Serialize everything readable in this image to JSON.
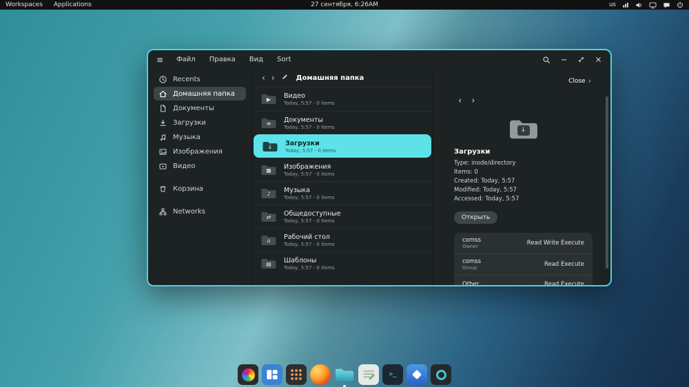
{
  "topbar": {
    "workspaces": "Workspaces",
    "applications": "Applications",
    "clock": "27 сентября, 6:26AM",
    "keyboard_layout": "us",
    "icons": [
      "network-icon",
      "volume-icon",
      "display-icon",
      "chat-icon",
      "power-icon"
    ]
  },
  "window": {
    "menus": [
      "Файл",
      "Правка",
      "Вид",
      "Sort"
    ],
    "sidebar": {
      "items": [
        {
          "label": "Recents",
          "icon": "clock-icon"
        },
        {
          "label": "Домашняя папка",
          "icon": "home-icon",
          "selected": true
        },
        {
          "label": "Документы",
          "icon": "document-icon"
        },
        {
          "label": "Загрузки",
          "icon": "download-icon"
        },
        {
          "label": "Музыка",
          "icon": "music-icon"
        },
        {
          "label": "Изображения",
          "icon": "image-icon"
        },
        {
          "label": "Видео",
          "icon": "video-icon"
        },
        {
          "label": "Корзина",
          "icon": "trash-icon"
        },
        {
          "label": "Networks",
          "icon": "network-icon"
        }
      ]
    },
    "pathbar": {
      "title": "Домашняя папка"
    },
    "files": [
      {
        "name": "Видео",
        "meta": "Today, 5:57 - 0 items",
        "glyph": "▶"
      },
      {
        "name": "Документы",
        "meta": "Today, 5:57 - 0 items",
        "glyph": "≡"
      },
      {
        "name": "Загрузки",
        "meta": "Today, 5:57 - 0 items",
        "glyph": "↓",
        "selected": true
      },
      {
        "name": "Изображения",
        "meta": "Today, 5:57 - 0 items",
        "glyph": "▦"
      },
      {
        "name": "Музыка",
        "meta": "Today, 5:57 - 0 items",
        "glyph": "♪"
      },
      {
        "name": "Общедоступные",
        "meta": "Today, 5:57 - 0 items",
        "glyph": "⇄"
      },
      {
        "name": "Рабочий стол",
        "meta": "Today, 5:57 - 0 items",
        "glyph": "⌂"
      },
      {
        "name": "Шаблоны",
        "meta": "Today, 5:57 - 0 items",
        "glyph": "▤"
      }
    ],
    "details": {
      "close_label": "Close",
      "close_chevron": "›",
      "title": "Загрузки",
      "folder_emblem": "↓",
      "props": [
        "Type: inode/directory",
        "Items: 0",
        "Created: Today, 5:57",
        "Modified: Today, 5:57",
        "Accessed: Today, 5:57"
      ],
      "open_label": "Открыть",
      "permissions": [
        {
          "user": "comss",
          "role": "Owner",
          "perms": "Read Write Execute"
        },
        {
          "user": "comss",
          "role": "Group",
          "perms": "Read Execute"
        },
        {
          "user": "Other",
          "role": "",
          "perms": "Read Execute"
        }
      ]
    }
  },
  "dock": {
    "items": [
      {
        "name": "screenshot-tool"
      },
      {
        "name": "window-tiling"
      },
      {
        "name": "app-grid"
      },
      {
        "name": "firefox"
      },
      {
        "name": "files",
        "active": true
      },
      {
        "name": "text-editor"
      },
      {
        "name": "terminal"
      },
      {
        "name": "app-store"
      },
      {
        "name": "camera"
      }
    ]
  },
  "colors": {
    "accent": "#52d1dd",
    "selection": "#5ee2e9",
    "window_bg": "#1d2223"
  }
}
